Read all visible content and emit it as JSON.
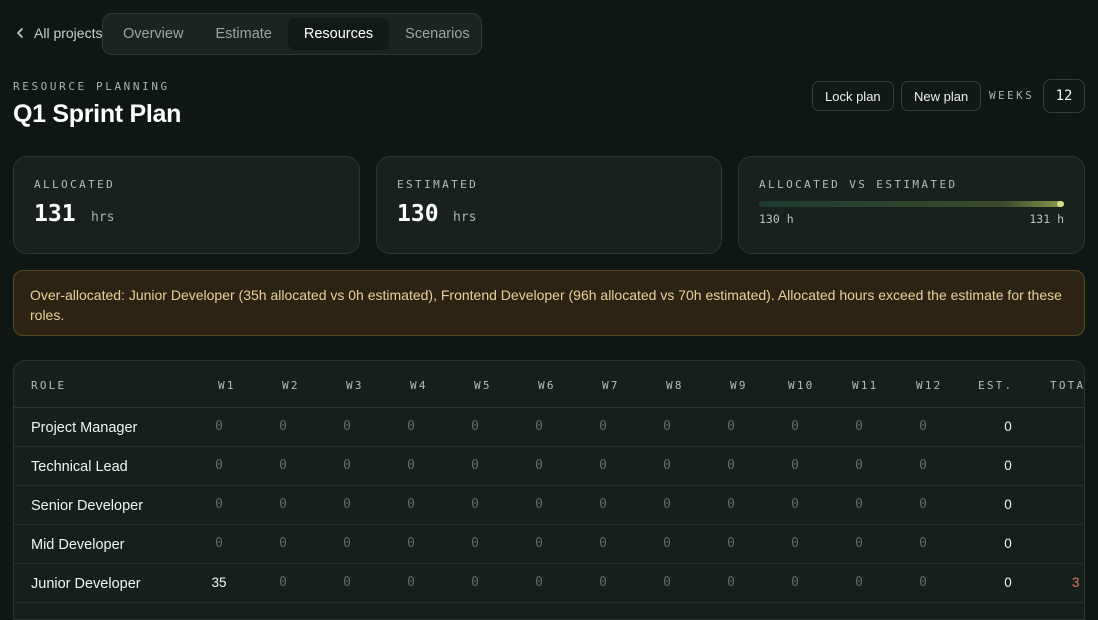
{
  "nav": {
    "back_label": "All projects",
    "tabs": [
      {
        "label": "Overview",
        "active": false
      },
      {
        "label": "Estimate",
        "active": false
      },
      {
        "label": "Resources",
        "active": true
      },
      {
        "label": "Scenarios",
        "active": false
      }
    ]
  },
  "header": {
    "eyebrow": "RESOURCE PLANNING",
    "title": "Q1 Sprint Plan",
    "lock_label": "Lock plan",
    "new_label": "New plan",
    "weeks_label": "WEEKS",
    "weeks_value": "12"
  },
  "stats": {
    "allocated": {
      "label": "ALLOCATED",
      "value": "131",
      "unit": "hrs"
    },
    "estimated": {
      "label": "ESTIMATED",
      "value": "130",
      "unit": "hrs"
    },
    "comparison": {
      "label": "ALLOCATED VS ESTIMATED",
      "left": "130 h",
      "right": "131 h",
      "fill_fraction": 1.0
    }
  },
  "warning": {
    "text": "Over-allocated: Junior Developer (35h allocated vs 0h estimated), Frontend Developer (96h allocated vs 70h estimated). Allocated hours exceed the estimate for these roles."
  },
  "table": {
    "headers": {
      "role": "ROLE",
      "weeks": [
        "W1",
        "W2",
        "W3",
        "W4",
        "W5",
        "W6",
        "W7",
        "W8",
        "W9",
        "W10",
        "W11",
        "W12"
      ],
      "est": "EST.",
      "total": "TOTA"
    },
    "rows": [
      {
        "role": "Project Manager",
        "weeks": [
          "0",
          "0",
          "0",
          "0",
          "0",
          "0",
          "0",
          "0",
          "0",
          "0",
          "0",
          "0"
        ],
        "est": "0",
        "total": ""
      },
      {
        "role": "Technical Lead",
        "weeks": [
          "0",
          "0",
          "0",
          "0",
          "0",
          "0",
          "0",
          "0",
          "0",
          "0",
          "0",
          "0"
        ],
        "est": "0",
        "total": ""
      },
      {
        "role": "Senior Developer",
        "weeks": [
          "0",
          "0",
          "0",
          "0",
          "0",
          "0",
          "0",
          "0",
          "0",
          "0",
          "0",
          "0"
        ],
        "est": "0",
        "total": ""
      },
      {
        "role": "Mid Developer",
        "weeks": [
          "0",
          "0",
          "0",
          "0",
          "0",
          "0",
          "0",
          "0",
          "0",
          "0",
          "0",
          "0"
        ],
        "est": "0",
        "total": ""
      },
      {
        "role": "Junior Developer",
        "weeks": [
          "35",
          "0",
          "0",
          "0",
          "0",
          "0",
          "0",
          "0",
          "0",
          "0",
          "0",
          "0"
        ],
        "est": "0",
        "total": "3"
      }
    ]
  },
  "colors": {
    "background": "#0f1714",
    "card": "#18211e",
    "warning_bg": "#2b2415",
    "warning_text": "#e9cf97",
    "over_total": "#e07a5a",
    "muted_zero": "#5f6a65"
  }
}
